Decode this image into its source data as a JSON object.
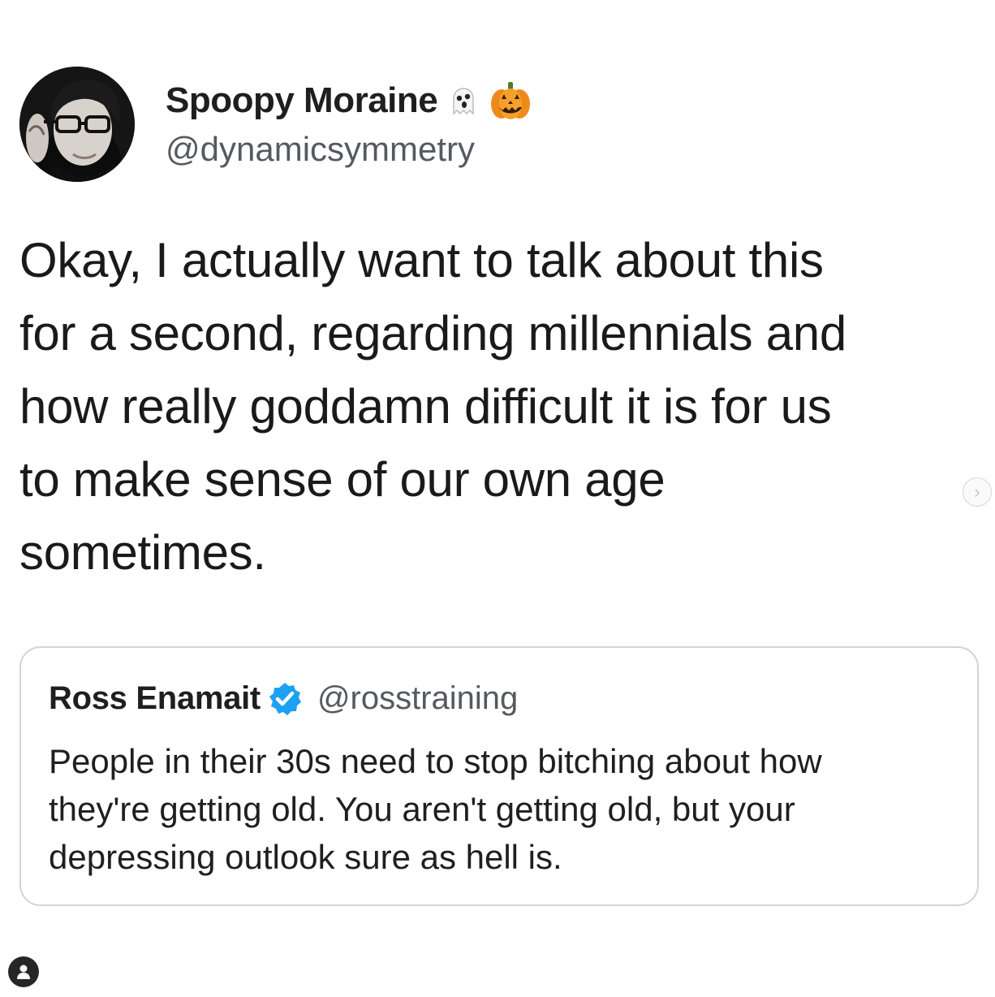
{
  "tweet": {
    "author": {
      "name": "Spoopy Moraine",
      "handle": "@dynamicsymmetry",
      "name_emojis": [
        "ghost-icon",
        "pumpkin-icon"
      ]
    },
    "text_lines": [
      "Okay, I actually want to talk about this",
      "for a second, regarding millennials and",
      "how really goddamn difficult it is for us",
      "to make sense of our own age",
      "sometimes."
    ],
    "quoted": {
      "name": "Ross Enamait",
      "verified": true,
      "handle": "@rosstraining",
      "text_lines": [
        "People in their 30s need to stop bitching about how",
        "they're getting old. You aren't getting old, but your",
        "depressing outlook sure as hell is."
      ]
    }
  },
  "ui": {
    "next_arrow": "›",
    "icons": {
      "next": "chevron-right-icon",
      "user_tag": "user-tag-icon"
    },
    "colors": {
      "verified_blue": "#1da1f2",
      "pumpkin_orange": "#f28c1b",
      "handle_gray": "#555a60",
      "card_border": "#d0d4d8"
    }
  }
}
